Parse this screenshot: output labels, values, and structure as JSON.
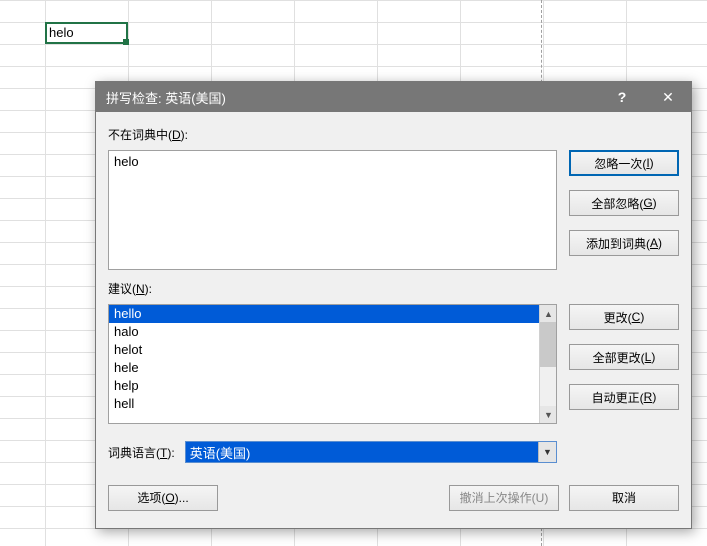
{
  "cell": {
    "value": "helo"
  },
  "dialog": {
    "title": "拼写检查: 英语(美国)",
    "help": "?",
    "close": "✕",
    "not_in_dict_label_pre": "不在词典中(",
    "not_in_dict_label_hot": "D",
    "not_in_dict_label_post": "):",
    "not_in_dict_value": "helo",
    "suggest_label_pre": "建议(",
    "suggest_label_hot": "N",
    "suggest_label_post": "):",
    "suggestions": [
      "hello",
      "halo",
      "helot",
      "hele",
      "help",
      "hell"
    ],
    "selected_suggestion_index": 0,
    "lang_label_pre": "词典语言(",
    "lang_label_hot": "T",
    "lang_label_post": "):",
    "lang_value": "英语(美国)",
    "buttons": {
      "ignore_once_pre": "忽略一次(",
      "ignore_once_hot": "I",
      "ignore_once_post": ")",
      "ignore_all_pre": "全部忽略(",
      "ignore_all_hot": "G",
      "ignore_all_post": ")",
      "add_dict_pre": "添加到词典(",
      "add_dict_hot": "A",
      "add_dict_post": ")",
      "change_pre": "更改(",
      "change_hot": "C",
      "change_post": ")",
      "change_all_pre": "全部更改(",
      "change_all_hot": "L",
      "change_all_post": ")",
      "autocorrect_pre": "自动更正(",
      "autocorrect_hot": "R",
      "autocorrect_post": ")",
      "options_pre": "选项(",
      "options_hot": "O",
      "options_post": ")...",
      "undo_last_pre": "撤消上次操作(",
      "undo_last_hot": "U",
      "undo_last_post": ")",
      "cancel": "取消"
    }
  }
}
